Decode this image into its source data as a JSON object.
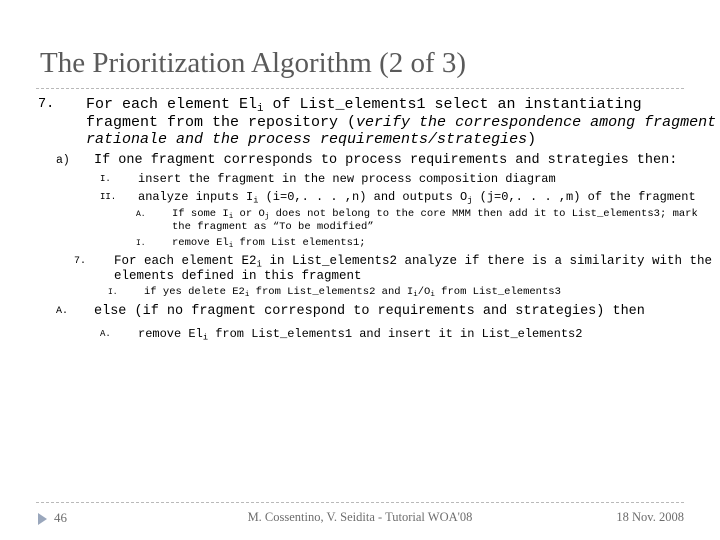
{
  "slide": {
    "title": "The Prioritization Algorithm (2 of 3)",
    "items": [
      {
        "marker": "7.",
        "level": "lvl1",
        "segments": [
          {
            "text": "For each element El",
            "style": "normal"
          },
          {
            "text": "i",
            "style": "sub"
          },
          {
            "text": " of List_elements1 select an instantiating fragment from the repository (",
            "style": "normal"
          },
          {
            "text": "verify the correspondence among fragment rationale and the process requirements/strategies",
            "style": "italic"
          },
          {
            "text": ")",
            "style": "normal"
          }
        ]
      },
      {
        "marker": "a)",
        "level": "lvl2",
        "segments": [
          {
            "text": "If one fragment corresponds to process requirements and strategies then:",
            "style": "normal"
          }
        ]
      },
      {
        "marker": "I.",
        "level": "lvl3",
        "segments": [
          {
            "text": "insert the fragment in the new process composition diagram",
            "style": "normal"
          }
        ]
      },
      {
        "marker": "II.",
        "level": "lvl3",
        "segments": [
          {
            "text": "analyze inputs I",
            "style": "normal"
          },
          {
            "text": "i",
            "style": "sub"
          },
          {
            "text": " (i=0,. . . ,n) and outputs O",
            "style": "normal"
          },
          {
            "text": "j",
            "style": "sub"
          },
          {
            "text": " (j=0,. . . ,m) of the fragment",
            "style": "normal"
          }
        ]
      },
      {
        "marker": "A.",
        "level": "lvl4",
        "segments": [
          {
            "text": "If some I",
            "style": "normal"
          },
          {
            "text": "i",
            "style": "sub"
          },
          {
            "text": " or O",
            "style": "normal"
          },
          {
            "text": "j",
            "style": "sub"
          },
          {
            "text": " does not belong to the core MMM then add it to List_elements3; mark the fragment as “To be modified”",
            "style": "normal"
          }
        ]
      },
      {
        "marker": "I.",
        "level": "lvl4",
        "segments": [
          {
            "text": "remove El",
            "style": "normal"
          },
          {
            "text": "i",
            "style": "sub"
          },
          {
            "text": " from List elements1;",
            "style": "normal"
          }
        ]
      },
      {
        "marker": "7.",
        "level": "lvl3b",
        "segments": [
          {
            "text": "For each element E2",
            "style": "normal"
          },
          {
            "text": "i",
            "style": "sub"
          },
          {
            "text": " in List_elements2 analyze if there is a similarity with the elements defined in this fragment",
            "style": "normal"
          }
        ]
      },
      {
        "marker": "I.",
        "level": "lvl4b",
        "segments": [
          {
            "text": "if yes delete E2",
            "style": "normal"
          },
          {
            "text": "i",
            "style": "sub"
          },
          {
            "text": " from List_elements2 and I",
            "style": "normal"
          },
          {
            "text": "i",
            "style": "sub"
          },
          {
            "text": "/O",
            "style": "normal"
          },
          {
            "text": "i",
            "style": "sub"
          },
          {
            "text": " from List_elements3",
            "style": "normal"
          }
        ]
      },
      {
        "marker": "A.",
        "level": "lvl2b",
        "segments": [
          {
            "text": "else (if no fragment correspond to requirements and strategies) then",
            "style": "normal"
          }
        ]
      },
      {
        "marker": "A.",
        "level": "lvl3c",
        "segments": [
          {
            "text": "remove El",
            "style": "normal"
          },
          {
            "text": "i",
            "style": "sub"
          },
          {
            "text": " from List_elements1 and insert it in List_elements2",
            "style": "normal"
          }
        ]
      }
    ]
  },
  "footer": {
    "page_number": "46",
    "center_text": "M. Cossentino, V. Seidita - Tutorial WOA'08",
    "date": "18 Nov. 2008",
    "triangle_color": "#9aa7bc"
  }
}
